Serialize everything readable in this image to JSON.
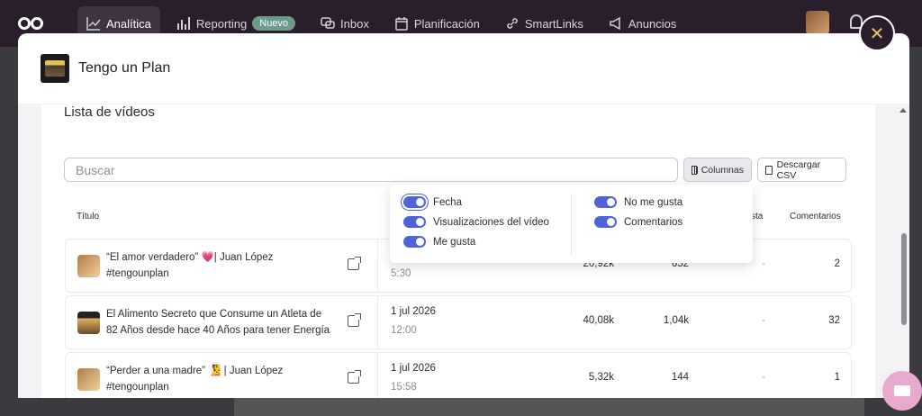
{
  "topnav": {
    "items": [
      {
        "label": "Analítica",
        "icon": "chart-line-icon",
        "active": true
      },
      {
        "label": "Reporting",
        "icon": "bar-chart-icon",
        "badge": "Nuevo"
      },
      {
        "label": "Inbox",
        "icon": "chat-bubbles-icon"
      },
      {
        "label": "Planificación",
        "icon": "calendar-icon"
      },
      {
        "label": "SmartLinks",
        "icon": "link-icon"
      },
      {
        "label": "Anuncios",
        "icon": "megaphone-icon"
      }
    ]
  },
  "modal": {
    "title": "Tengo un Plan",
    "close_glyph": "✕"
  },
  "section": {
    "title": "Lista de vídeos",
    "search_placeholder": "Buscar",
    "columns_button": "Columnas",
    "csv_button": "Descargar CSV"
  },
  "table": {
    "headers": {
      "title": "Título",
      "likes_partial": "sta",
      "comments": "Comentarios"
    },
    "rows": [
      {
        "title": "“El amor verdadero” 💗| Juan López #tengounplan",
        "date": "",
        "time": "5:30",
        "views": "20,92k",
        "likes": "652",
        "dislikes": "-",
        "comments": "2"
      },
      {
        "title": "El Alimento Secreto que Consume un Atleta de 82 Años desde hace 40 Años para tener Energía",
        "date": "1 jul 2026",
        "time": "12:00",
        "views": "40,08k",
        "likes": "1,04k",
        "dislikes": "-",
        "comments": "32"
      },
      {
        "title": "“Perder a una madre” 🧏 | Juan López #tengounplan",
        "date": "1 jul 2026",
        "time": "15:58",
        "views": "5,32k",
        "likes": "144",
        "dislikes": "-",
        "comments": "1"
      }
    ]
  },
  "columns_popover": {
    "left": [
      {
        "label": "Fecha",
        "on": true
      },
      {
        "label": "Visualizaciones del vídeo",
        "on": true
      },
      {
        "label": "Me gusta",
        "on": true
      }
    ],
    "right": [
      {
        "label": "No me gusta",
        "on": true
      },
      {
        "label": "Comentarios",
        "on": true
      }
    ]
  },
  "colors": {
    "accent": "#4f63d8",
    "nav_bg": "#2b1e2c",
    "close_icon": "#e8c274",
    "chat_fab": "#e8a9cf"
  }
}
